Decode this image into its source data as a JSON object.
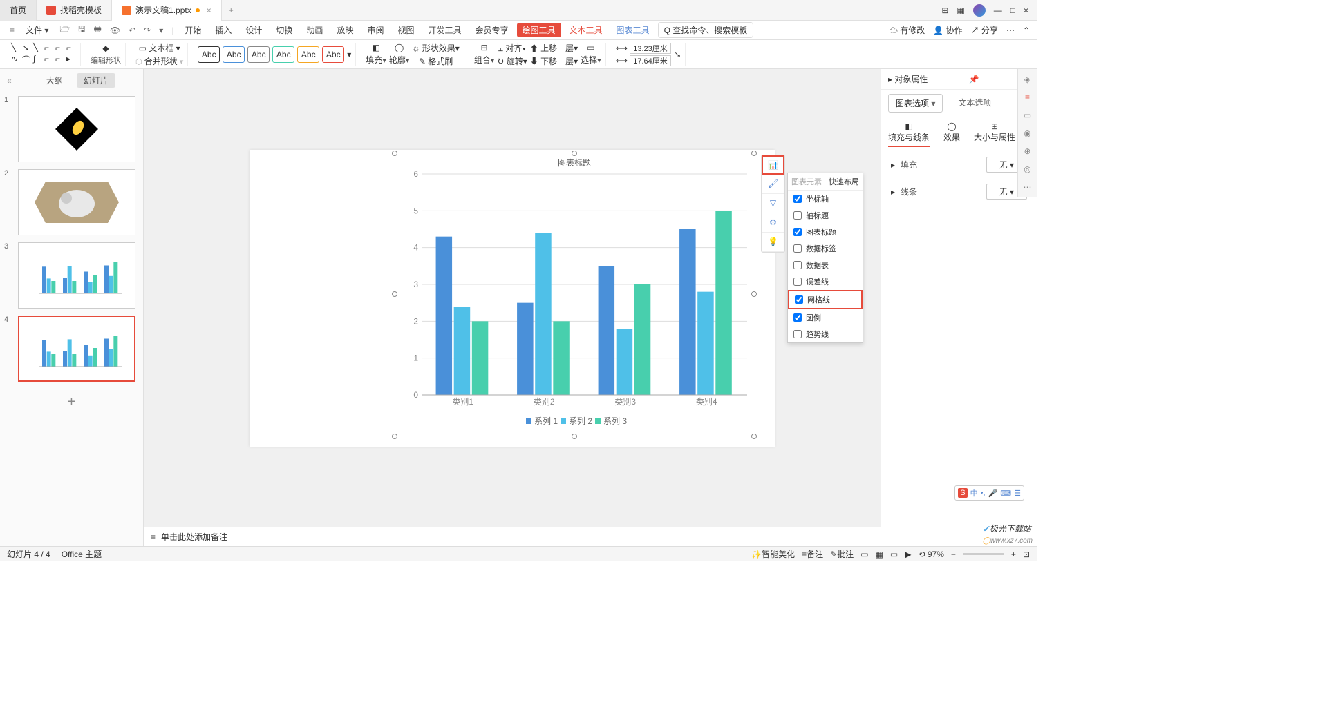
{
  "tabs": {
    "home": "首页",
    "template": "找稻壳模板",
    "file": "演示文稿1.pptx"
  },
  "menu": {
    "file": "文件",
    "items": [
      "开始",
      "插入",
      "设计",
      "切换",
      "动画",
      "放映",
      "审阅",
      "视图",
      "开发工具",
      "会员专享"
    ],
    "draw": "绘图工具",
    "text": "文本工具",
    "chart": "图表工具",
    "search": "查找命令、搜索模板",
    "search_prefix": "Q"
  },
  "topright": {
    "changes": "有修改",
    "collab": "协作",
    "share": "分享"
  },
  "ribbon": {
    "editshape": "编辑形状",
    "textbox": "文本框",
    "merge": "合并形状",
    "abc": "Abc",
    "fill": "填充",
    "outline": "轮廓",
    "effect": "形状效果",
    "fmtpaint": "格式刷",
    "group": "组合",
    "align": "对齐",
    "rotate": "旋转",
    "up": "上移一层",
    "down": "下移一层",
    "select": "选择",
    "w": "13.23厘米",
    "h": "17.64厘米"
  },
  "left": {
    "outline": "大纲",
    "slides": "幻灯片"
  },
  "chart_data": {
    "type": "bar",
    "title": "图表标题",
    "categories": [
      "类别1",
      "类别2",
      "类别3",
      "类别4"
    ],
    "series": [
      {
        "name": "系列 1",
        "color": "#4a90d9",
        "values": [
          4.3,
          2.5,
          3.5,
          4.5
        ]
      },
      {
        "name": "系列 2",
        "color": "#4fc0e8",
        "values": [
          2.4,
          4.4,
          1.8,
          2.8
        ]
      },
      {
        "name": "系列 3",
        "color": "#48cfad",
        "values": [
          2.0,
          2.0,
          3.0,
          5.0
        ]
      }
    ],
    "ylim": [
      0,
      6
    ],
    "yticks": [
      0,
      1,
      2,
      3,
      4,
      5,
      6
    ]
  },
  "popup": {
    "tab1": "图表元素",
    "tab2": "快速布局",
    "items": [
      {
        "label": "坐标轴",
        "checked": true
      },
      {
        "label": "轴标题",
        "checked": false
      },
      {
        "label": "图表标题",
        "checked": true
      },
      {
        "label": "数据标签",
        "checked": false
      },
      {
        "label": "数据表",
        "checked": false
      },
      {
        "label": "误差线",
        "checked": false
      },
      {
        "label": "网格线",
        "checked": true,
        "highlight": true
      },
      {
        "label": "图例",
        "checked": true
      },
      {
        "label": "趋势线",
        "checked": false
      }
    ]
  },
  "props": {
    "title": "对象属性",
    "opt": "图表选项",
    "txtopt": "文本选项",
    "fillline": "填充与线条",
    "effect": "效果",
    "sizeprops": "大小与属性",
    "fill": "填充",
    "line": "线条",
    "none": "无"
  },
  "notes": "单击此处添加备注",
  "status": {
    "slide": "幻灯片 4 / 4",
    "theme": "Office 主题",
    "beautify": "智能美化",
    "notes": "备注",
    "comment": "批注",
    "zoom": "97%"
  },
  "watermark": {
    "name": "极光下载站",
    "url": "www.xz7.com"
  }
}
